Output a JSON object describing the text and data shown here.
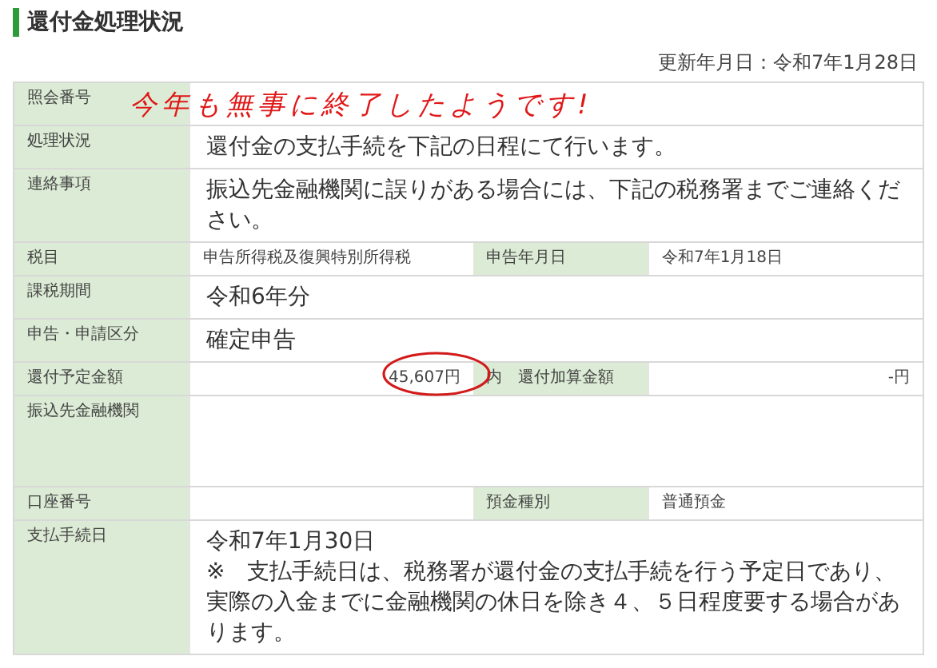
{
  "heading": "還付金処理状況",
  "updated": "更新年月日：令和7年1月28日",
  "annotation": "今年も無事に終了したようです!",
  "rows": [
    {
      "kind": "full",
      "label": "照会番号"
    },
    {
      "kind": "full",
      "label": "処理状況",
      "value": "還付金の支払手続を下記の日程にて行います。"
    },
    {
      "kind": "full",
      "label": "連絡事項",
      "value": "振込先金融機関に誤りがある場合には、下記の税務署までご連絡ください。"
    },
    {
      "kind": "split",
      "cells": [
        {
          "label": "税目",
          "value": "申告所得税及復興特別所得税",
          "kind": "text"
        },
        {
          "label": "申告年月日",
          "value": "令和7年1月18日",
          "kind": "text"
        }
      ]
    },
    {
      "kind": "full",
      "label": "課税期間",
      "value": "令和6年分"
    },
    {
      "kind": "full",
      "label": "申告・申請区分",
      "value": "確定申告"
    },
    {
      "kind": "split",
      "cells": [
        {
          "label": "還付予定金額",
          "value": "45,607円",
          "kind": "amount",
          "circled": true
        },
        {
          "label": "内　還付加算金額",
          "value": "-円",
          "kind": "amount"
        }
      ]
    },
    {
      "kind": "blank",
      "label": "振込先金融機関"
    },
    {
      "kind": "split",
      "cells": [
        {
          "label": "口座番号",
          "kind": "text"
        },
        {
          "label": "預金種別",
          "value": "普通預金",
          "kind": "text"
        }
      ]
    },
    {
      "kind": "full",
      "label": "支払手続日",
      "value": "令和7年1月30日",
      "note": "※　支払手続日は、税務署が還付金の支払手続を行う予定日であり、実際の入金までに金融機関の休日を除き４、５日程度要する場合があります。"
    }
  ]
}
